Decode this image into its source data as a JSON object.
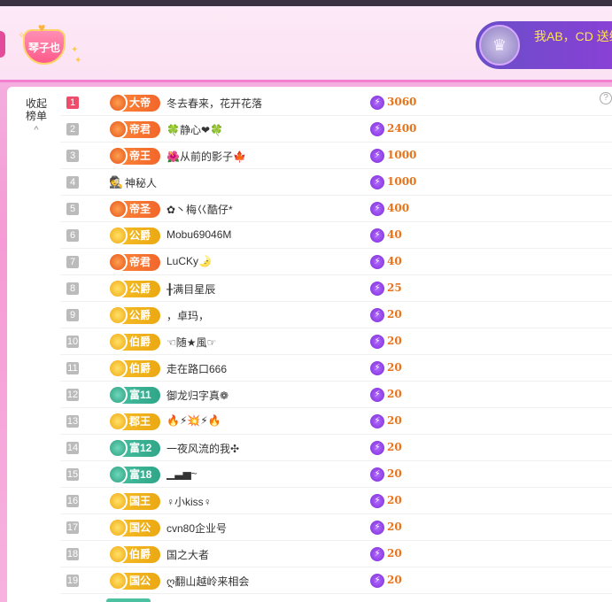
{
  "header": {
    "host_name": "琴子也",
    "gift_banner_text": "我AB，CD 送给 园"
  },
  "sidebar": {
    "collapse_label": "收起榜单",
    "collapse_arrow": "^"
  },
  "help_label": "?",
  "leaderboard": [
    {
      "rank": "1",
      "badge": "大帝",
      "badge_style": "orange",
      "name": "冬去春来，花开花落",
      "score": "3060"
    },
    {
      "rank": "2",
      "badge": "帝君",
      "badge_style": "orange",
      "name": "🍀静心❤🍀",
      "score": "2400"
    },
    {
      "rank": "3",
      "badge": "帝王",
      "badge_style": "orange",
      "name": "🌺从前的影子🍁",
      "score": "1000"
    },
    {
      "rank": "4",
      "badge": "",
      "badge_style": "none",
      "name": "神秘人",
      "score": "1000"
    },
    {
      "rank": "5",
      "badge": "帝圣",
      "badge_style": "orange",
      "name": "✿丶梅巜酷仔*",
      "score": "400"
    },
    {
      "rank": "6",
      "badge": "公爵",
      "badge_style": "gold",
      "name": "Mobu69046M",
      "score": "40"
    },
    {
      "rank": "7",
      "badge": "帝君",
      "badge_style": "orange",
      "name": "LuCKy🌛",
      "score": "40"
    },
    {
      "rank": "8",
      "badge": "公爵",
      "badge_style": "gold",
      "name": "╂满目星辰",
      "score": "25"
    },
    {
      "rank": "9",
      "badge": "公爵",
      "badge_style": "gold",
      "name": "，卓玛，",
      "score": "20"
    },
    {
      "rank": "10",
      "badge": "伯爵",
      "badge_style": "gold",
      "name": "☜随★風☞",
      "score": "20"
    },
    {
      "rank": "11",
      "badge": "伯爵",
      "badge_style": "gold",
      "name": "走在路口666",
      "score": "20"
    },
    {
      "rank": "12",
      "badge": "富11",
      "badge_style": "teal",
      "name": "御龙归字真❁",
      "score": "20"
    },
    {
      "rank": "13",
      "badge": "郡王",
      "badge_style": "gold",
      "name": "🔥⚡💥⚡🔥",
      "score": "20"
    },
    {
      "rank": "14",
      "badge": "富12",
      "badge_style": "teal",
      "name": "一夜风流的我✣",
      "score": "20"
    },
    {
      "rank": "15",
      "badge": "富18",
      "badge_style": "teal",
      "name": "▁▃▅~",
      "score": "20"
    },
    {
      "rank": "16",
      "badge": "国王",
      "badge_style": "gold",
      "name": "♀小kiss♀",
      "score": "20"
    },
    {
      "rank": "17",
      "badge": "国公",
      "badge_style": "gold",
      "name": "cvn80企业号",
      "score": "20"
    },
    {
      "rank": "18",
      "badge": "伯爵",
      "badge_style": "gold",
      "name": "国之大者",
      "score": "20"
    },
    {
      "rank": "19",
      "badge": "国公",
      "badge_style": "gold",
      "name": "ღ翻山越岭来相会",
      "score": "20"
    }
  ]
}
